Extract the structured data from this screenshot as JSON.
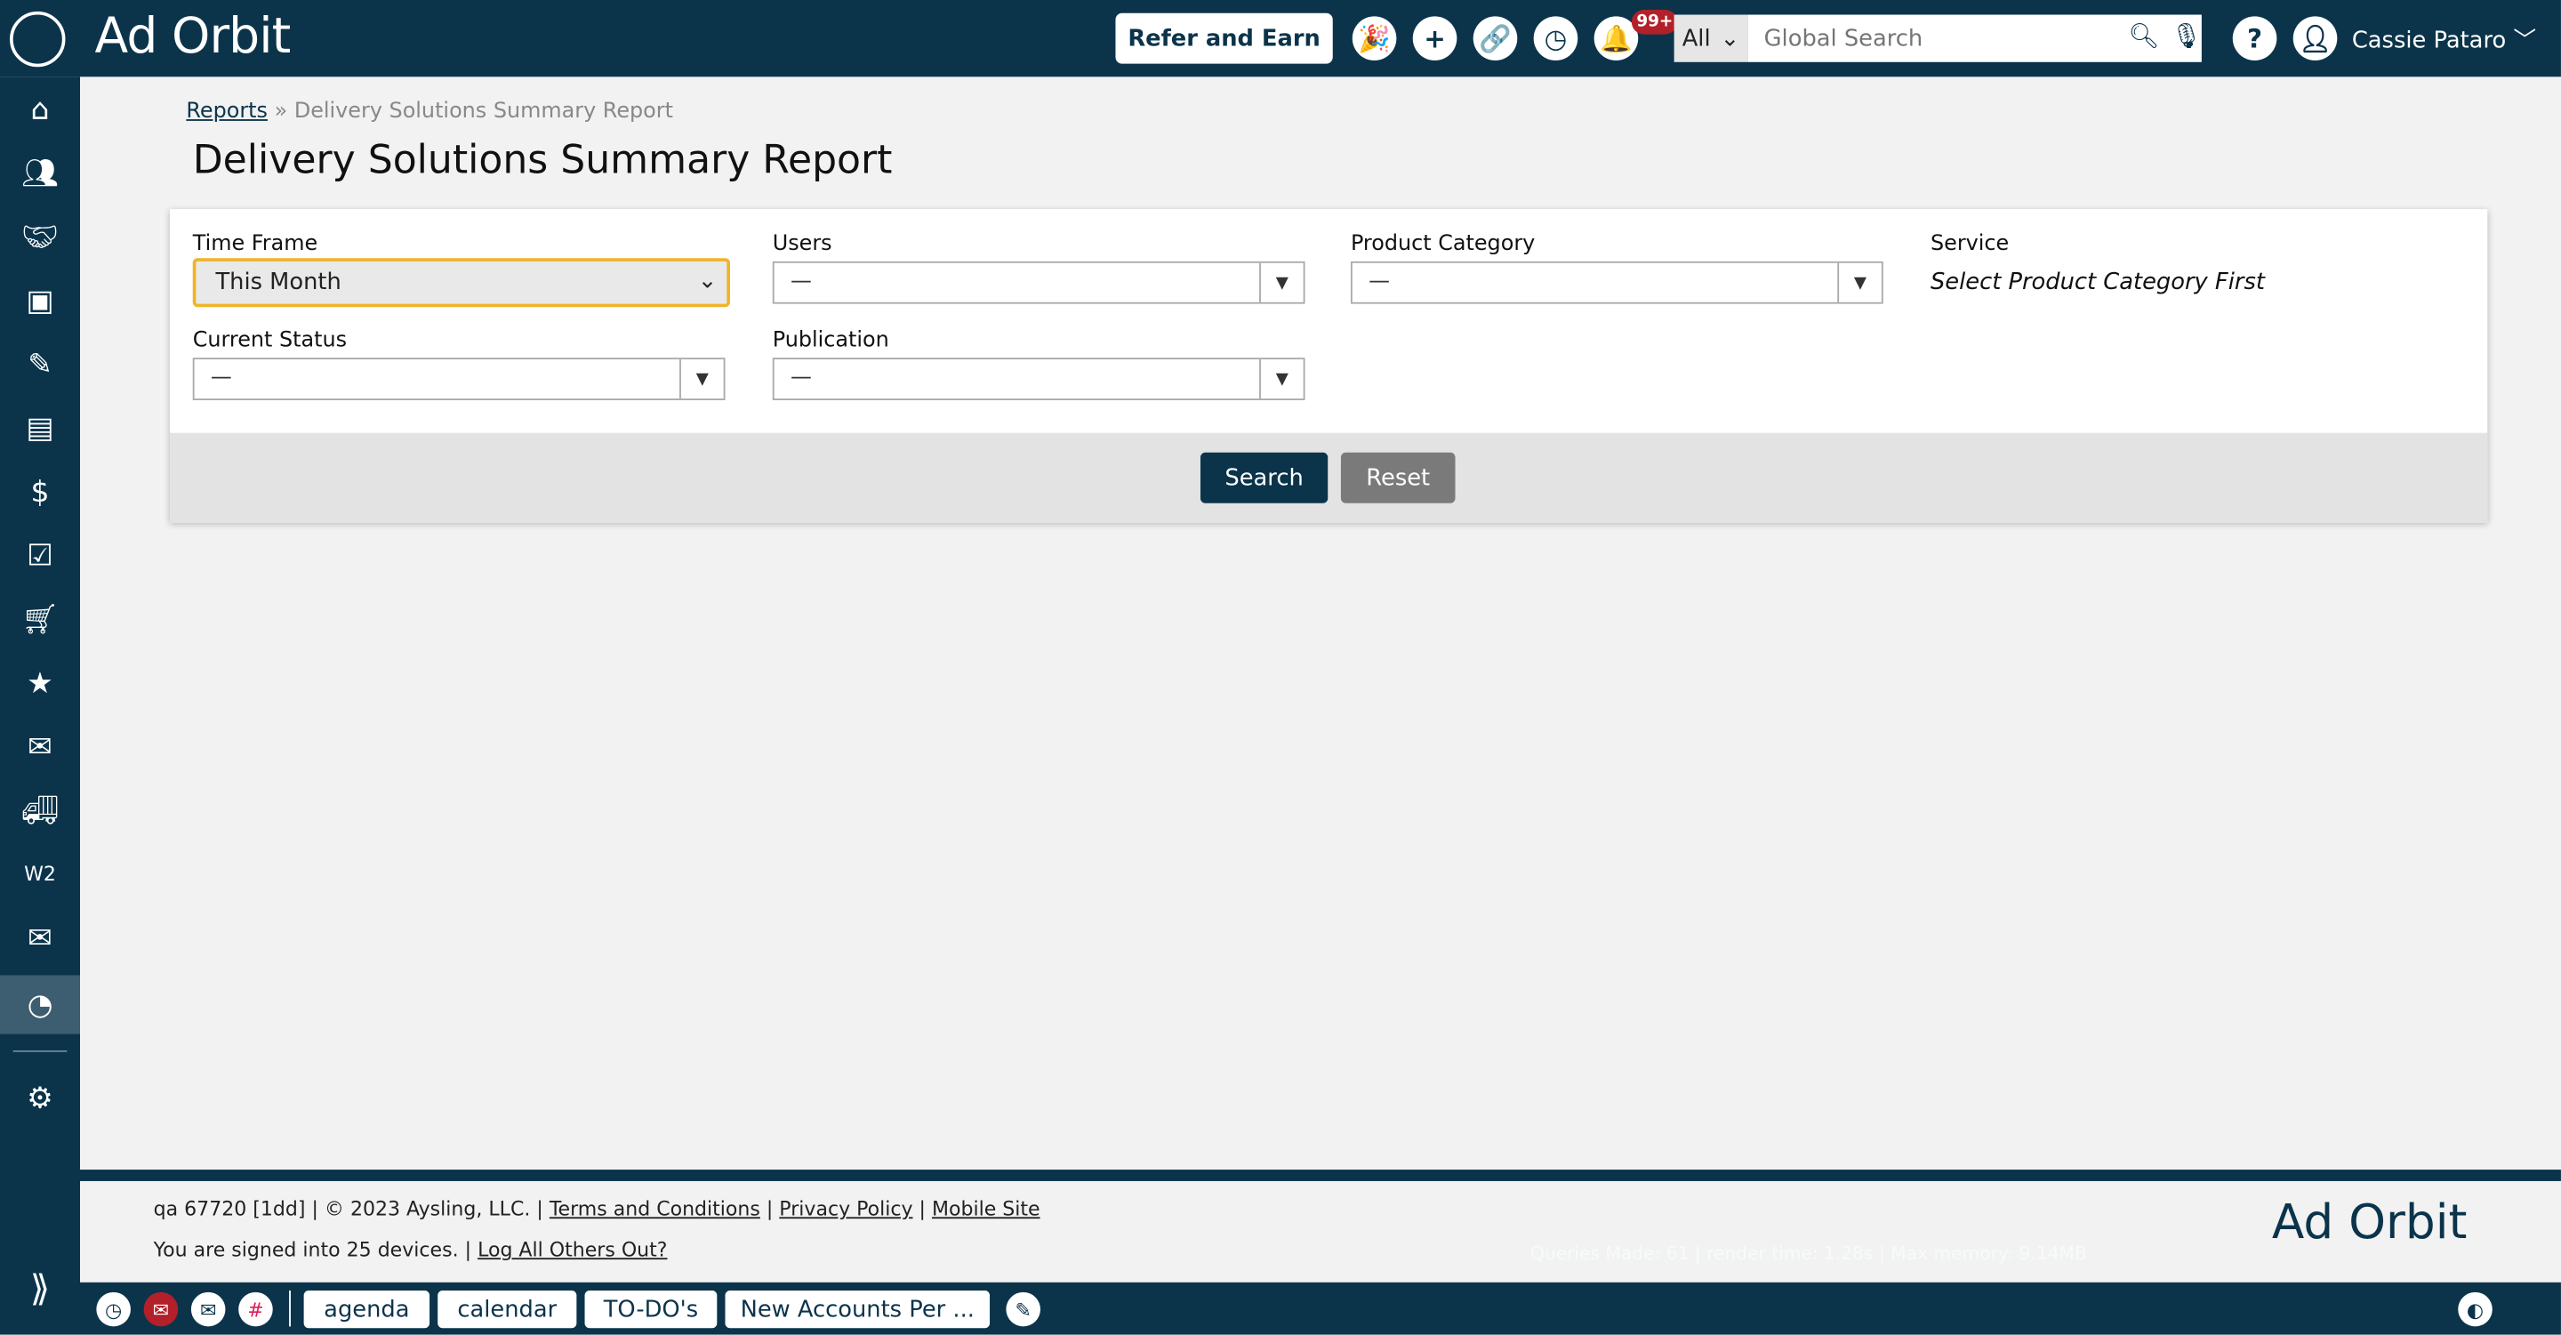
{
  "header": {
    "logo": "Ad Orbit",
    "refer_label": "Refer and Earn",
    "notification_count": "99+",
    "search_scope": "All",
    "search_placeholder": "Global Search",
    "user_name": "Cassie Pataro"
  },
  "sidebar": {
    "items": [
      "home",
      "contacts",
      "deals",
      "media",
      "tickets",
      "invoices",
      "billing",
      "tasks",
      "orders",
      "calendar",
      "mailbox",
      "delivery",
      "w2",
      "email",
      "reports",
      "settings"
    ],
    "active": "reports"
  },
  "breadcrumb": {
    "parent": "Reports",
    "separator": "»",
    "current": "Delivery Solutions Summary Report"
  },
  "page_title": "Delivery Solutions Summary Report",
  "filters": {
    "time_frame": {
      "label": "Time Frame",
      "value": "This Month"
    },
    "users": {
      "label": "Users",
      "value": "—"
    },
    "product_category": {
      "label": "Product Category",
      "value": "—"
    },
    "service": {
      "label": "Service",
      "hint": "Select Product Category First"
    },
    "current_status": {
      "label": "Current Status",
      "value": "—"
    },
    "publication": {
      "label": "Publication",
      "value": "—"
    }
  },
  "actions": {
    "search": "Search",
    "reset": "Reset"
  },
  "footer": {
    "version": "qa 67720 [1dd] | © 2023 Aysling, LLC. |",
    "terms": "Terms and Conditions",
    "privacy": "Privacy Policy",
    "mobile": "Mobile Site",
    "devices": "You are signed into 25 devices. |",
    "logout_others": "Log All Others Out?",
    "debug": "Queries Made: 61 | render time: 1.28s | Max memory: 9.14MB",
    "logo": "Ad Orbit"
  },
  "dock": {
    "tabs": [
      "agenda",
      "calendar",
      "TO-DO's",
      "New Accounts Per ..."
    ]
  },
  "colors": {
    "navy": "#0b344b",
    "accent_focus": "#f0b429",
    "badge": "#b3202a",
    "reset": "#7a7a7a"
  }
}
